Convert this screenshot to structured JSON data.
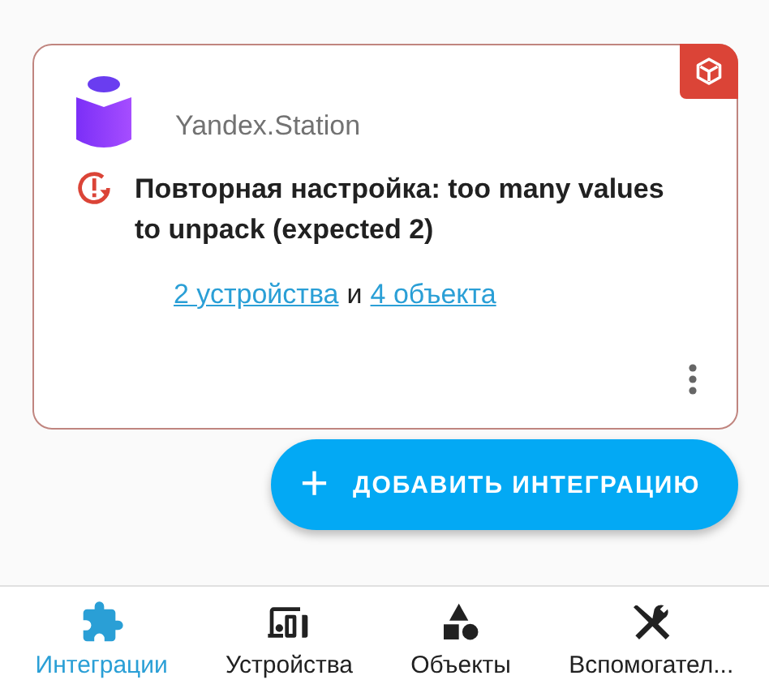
{
  "integration_card": {
    "subtitle": "Yandex.Station",
    "error": "Повторная настройка: too many values to unpack (expected 2)",
    "links": [
      {
        "text": "2 устройства"
      },
      {
        "text": "4 объекта"
      }
    ],
    "link_joiner": "и"
  },
  "add_button": {
    "icon": "+",
    "label": "ДОБАВИТЬ ИНТЕГРАЦИЮ"
  },
  "bottom_nav": [
    {
      "kind": "integrations",
      "label": "Интеграции",
      "selected": true
    },
    {
      "kind": "devices",
      "label": "Устройства",
      "selected": false
    },
    {
      "kind": "entities",
      "label": "Объекты",
      "selected": false
    },
    {
      "kind": "tools",
      "label": "Вспомогател...",
      "selected": false
    }
  ]
}
